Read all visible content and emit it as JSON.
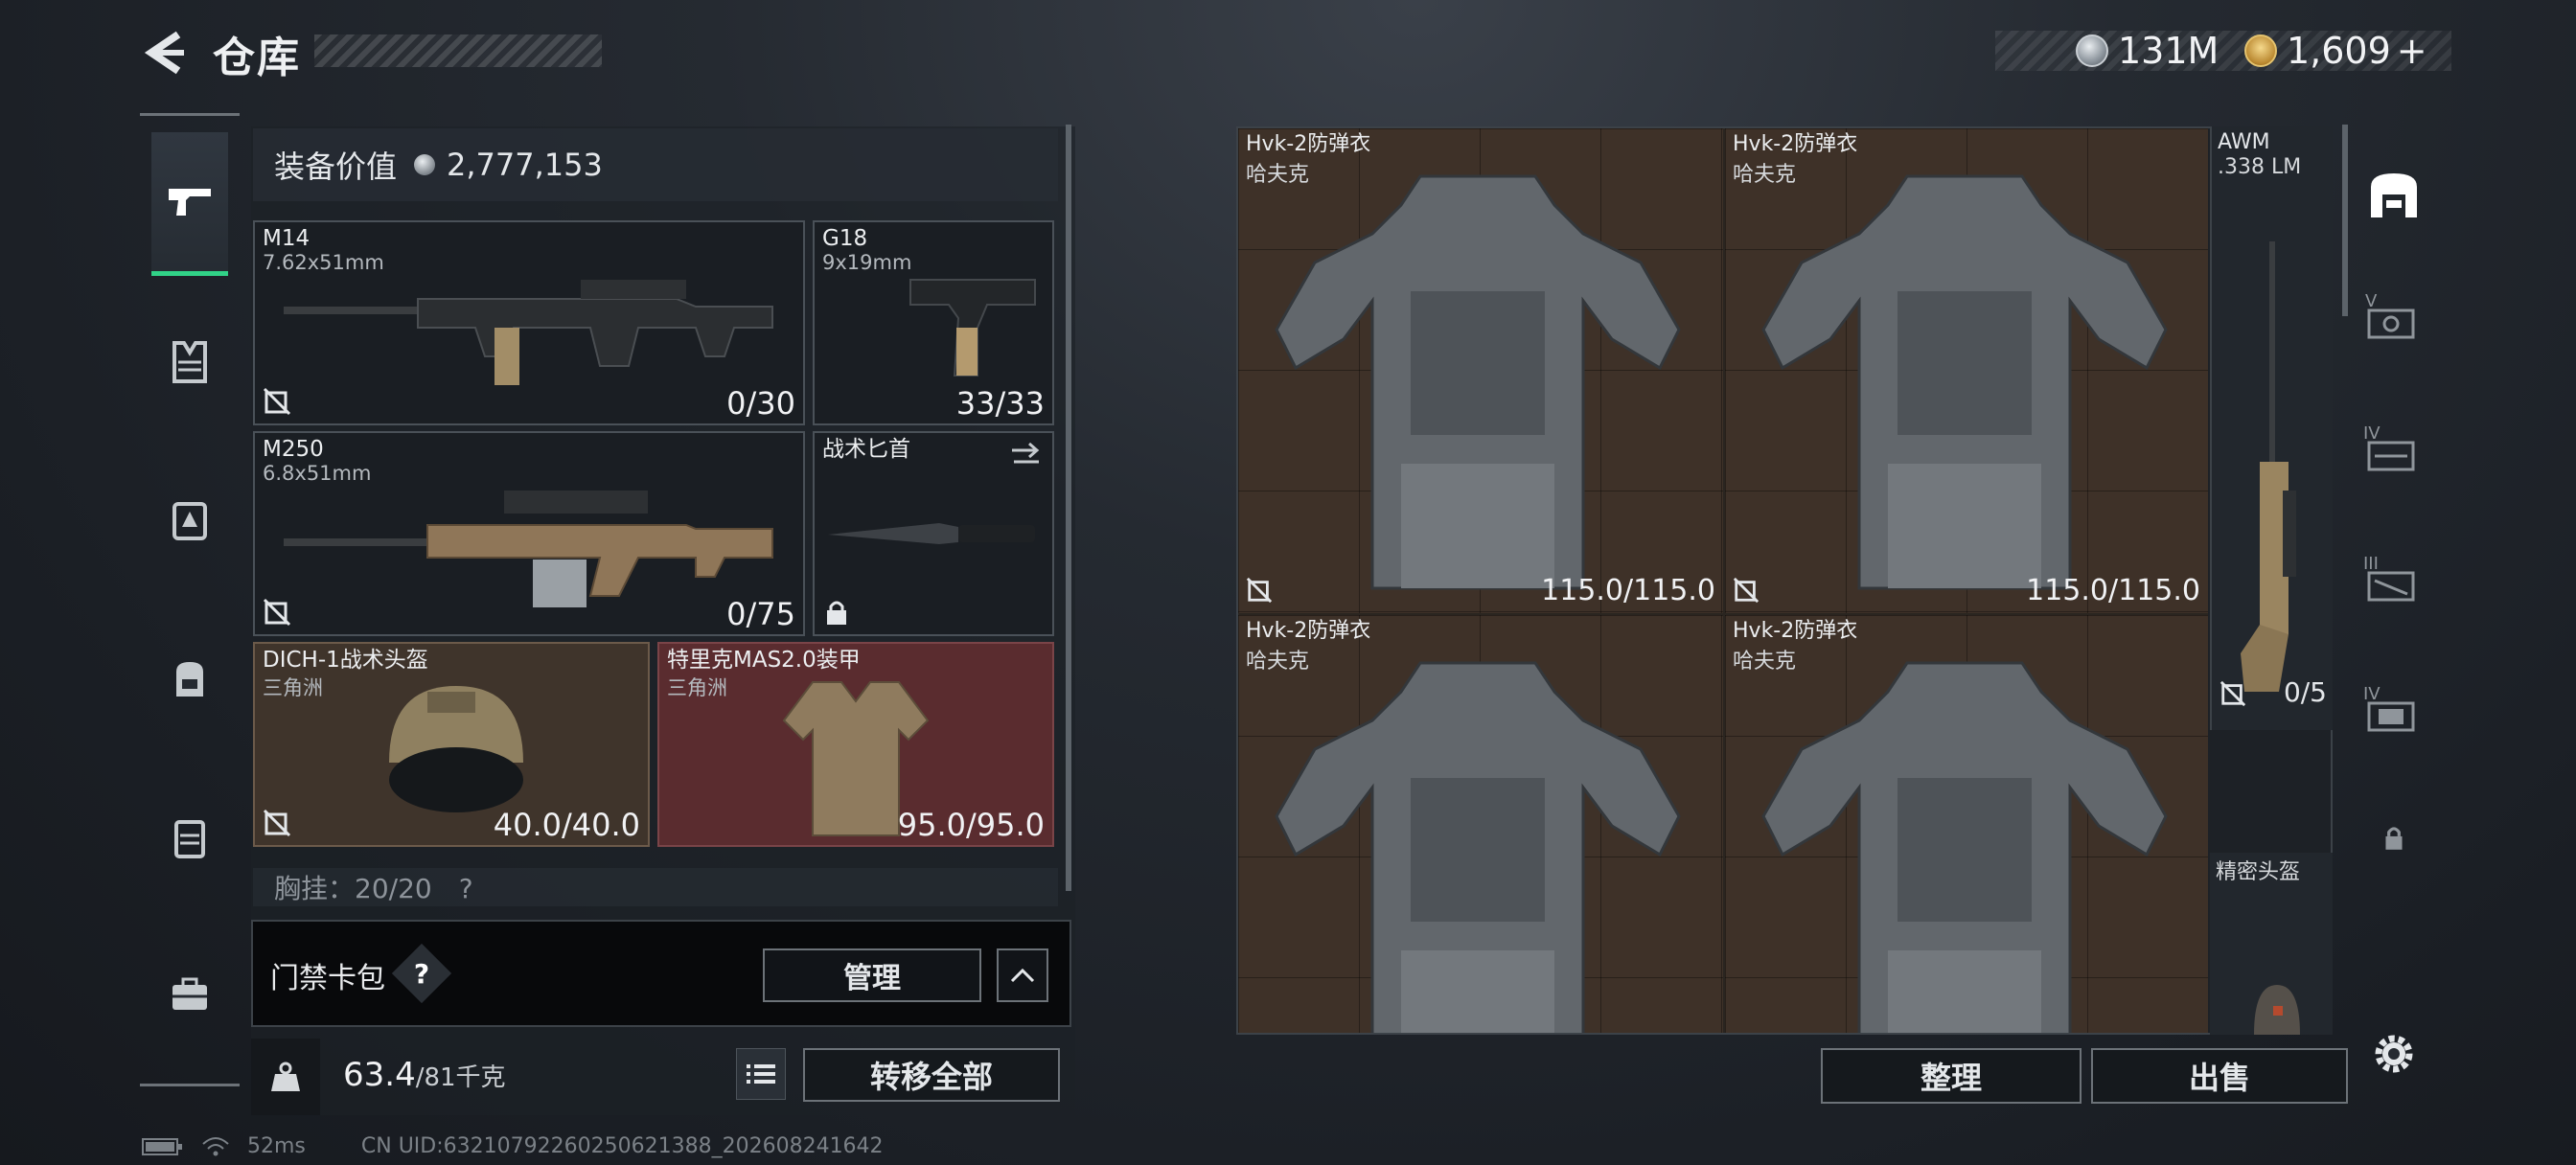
{
  "header": {
    "title": "仓库",
    "cash_amount": "131M",
    "premium_amount": "1,609",
    "premium_add": "+"
  },
  "left_rail": {
    "items": [
      {
        "name": "weapons",
        "active": true
      },
      {
        "name": "armor"
      },
      {
        "name": "backpack-rig"
      },
      {
        "name": "backpack"
      },
      {
        "name": "container"
      },
      {
        "name": "briefcase"
      }
    ]
  },
  "equipment": {
    "value_label": "装备价值",
    "value": "2,777,153",
    "slots": [
      {
        "name": "M14",
        "sub": "7.62x51mm",
        "durability": "0/30"
      },
      {
        "name": "G18",
        "sub": "9x19mm",
        "durability": "33/33"
      },
      {
        "name": "M250",
        "sub": "6.8x51mm",
        "durability": "0/75"
      },
      {
        "name": "战术匕首",
        "sub": "",
        "durability": ""
      },
      {
        "name": "DICH-1战术头盔",
        "sub": "三角洲",
        "durability": "40.0/40.0"
      },
      {
        "name": "特里克MAS2.0装甲",
        "sub": "三角洲",
        "durability": "95.0/95.0"
      }
    ],
    "chest_rig_partial": "胸挂：20/20　?"
  },
  "card_bar": {
    "label": "门禁卡包",
    "help": "?",
    "manage": "管理"
  },
  "weight": {
    "current": "63.4",
    "max_unit": "/81千克"
  },
  "transfer_all": "转移全部",
  "status": {
    "ping": "52ms",
    "uid": "CN UID:632107922602506213​88_202608241642"
  },
  "storage": {
    "items": [
      {
        "name": "Hvk-2防弹衣",
        "sub": "哈夫克",
        "durability": "115.0/115.0"
      },
      {
        "name": "Hvk-2防弹衣",
        "sub": "哈夫克",
        "durability": "115.0/115.0"
      },
      {
        "name": "Hvk-2防弹衣",
        "sub": "哈夫克",
        "durability": ""
      },
      {
        "name": "Hvk-2防弹衣",
        "sub": "哈夫克",
        "durability": ""
      }
    ],
    "awm": {
      "name": "AWM",
      "sub": ".338 LM",
      "durability": "0/5"
    },
    "helmet_label": "精密头盔"
  },
  "right_rail": {
    "tiers": [
      "V",
      "IV",
      "III",
      "IV"
    ]
  },
  "actions": {
    "sort": "整理",
    "sell": "出售"
  },
  "colors": {
    "accent_green": "#31d287",
    "cell_brown": "#3e3128",
    "cell_red": "#5a2c2f"
  }
}
